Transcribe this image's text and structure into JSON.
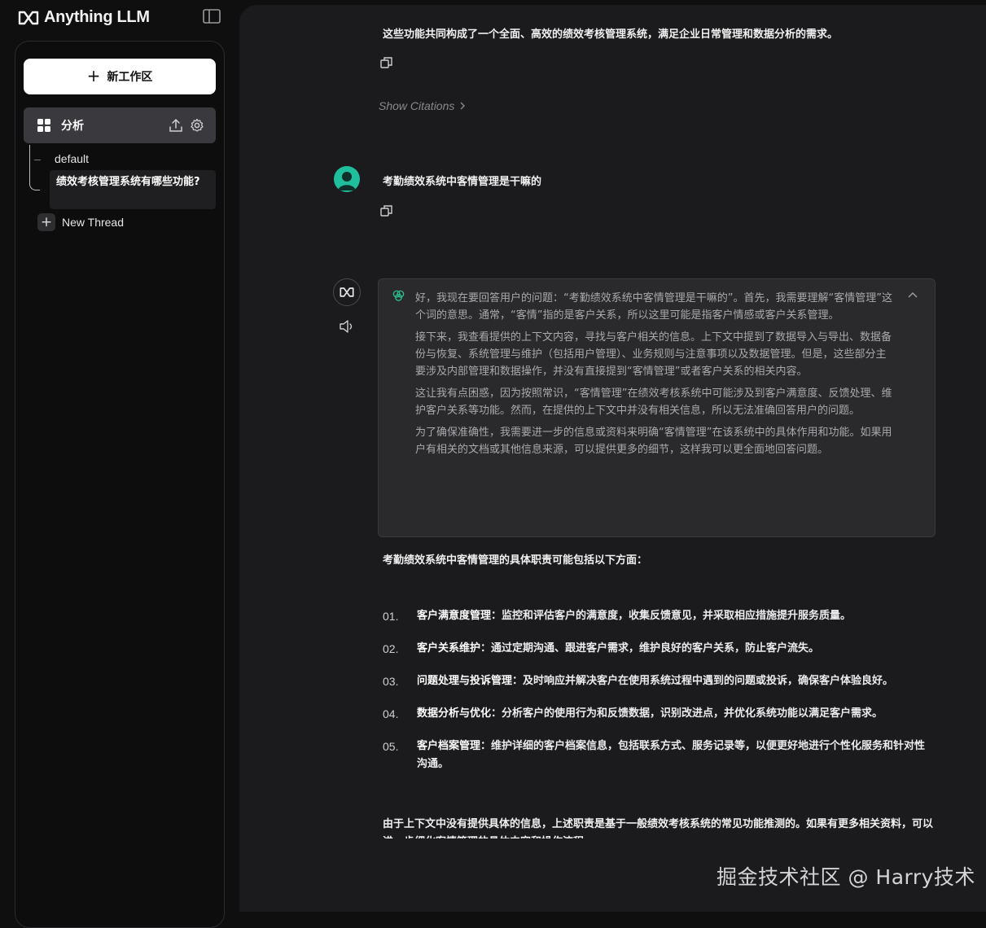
{
  "app": {
    "name": "Anything LLM"
  },
  "sidebar": {
    "new_workspace_label": "新工作区",
    "workspace": {
      "name": "分析"
    },
    "threads": [
      {
        "label": "default"
      },
      {
        "label": "绩效考核管理系统有哪些功能?"
      }
    ],
    "new_thread_label": "New Thread"
  },
  "chat": {
    "prev_answer_tail": "这些功能共同构成了一个全面、高效的绩效考核管理系统，满足企业日常管理和数据分析的需求。",
    "show_citations": "Show Citations",
    "user_message": "考勤绩效系统中客情管理是干嘛的",
    "thinking": [
      "好，我现在要回答用户的问题：“考勤绩效系统中客情管理是干嘛的”。首先，我需要理解“客情管理”这个词的意思。通常，“客情”指的是客户关系，所以这里可能是指客户情感或客户关系管理。",
      "接下来，我查看提供的上下文内容，寻找与客户相关的信息。上下文中提到了数据导入与导出、数据备份与恢复、系统管理与维护（包括用户管理）、业务规则与注意事项以及数据管理。但是，这些部分主要涉及内部管理和数据操作，并没有直接提到“客情管理”或者客户关系的相关内容。",
      "这让我有点困惑，因为按照常识，“客情管理”在绩效考核系统中可能涉及到客户满意度、反馈处理、维护客户关系等功能。然而，在提供的上下文中并没有相关信息，所以无法准确回答用户的问题。",
      "为了确保准确性，我需要进一步的信息或资料来明确“客情管理”在该系统中的具体作用和功能。如果用户有相关的文档或其他信息来源，可以提供更多的细节，这样我可以更全面地回答问题。"
    ],
    "answer_intro": "考勤绩效系统中客情管理的具体职责可能包括以下方面：",
    "answer_items": [
      {
        "num": "01.",
        "title": "客户满意度管理",
        "text": "：监控和评估客户的满意度，收集反馈意见，并采取相应措施提升服务质量。"
      },
      {
        "num": "02.",
        "title": "客户关系维护",
        "text": "：通过定期沟通、跟进客户需求，维护良好的客户关系，防止客户流失。"
      },
      {
        "num": "03.",
        "title": "问题处理与投诉管理",
        "text": "：及时响应并解决客户在使用系统过程中遇到的问题或投诉，确保客户体验良好。"
      },
      {
        "num": "04.",
        "title": "数据分析与优化",
        "text": "：分析客户的使用行为和反馈数据，识别改进点，并优化系统功能以满足客户需求。"
      },
      {
        "num": "05.",
        "title": "客户档案管理",
        "text": "：维护详细的客户档案信息，包括联系方式、服务记录等，以便更好地进行个性化服务和针对性沟通。"
      }
    ],
    "answer_outro": "由于上下文中没有提供具体的信息，上述职责是基于一般绩效考核系统的常见功能推测的。如果有更多相关资料，可以进一步细化客情管理的具体内容和操作流程。"
  },
  "watermark": "掘金技术社区 @ Harry技术"
}
